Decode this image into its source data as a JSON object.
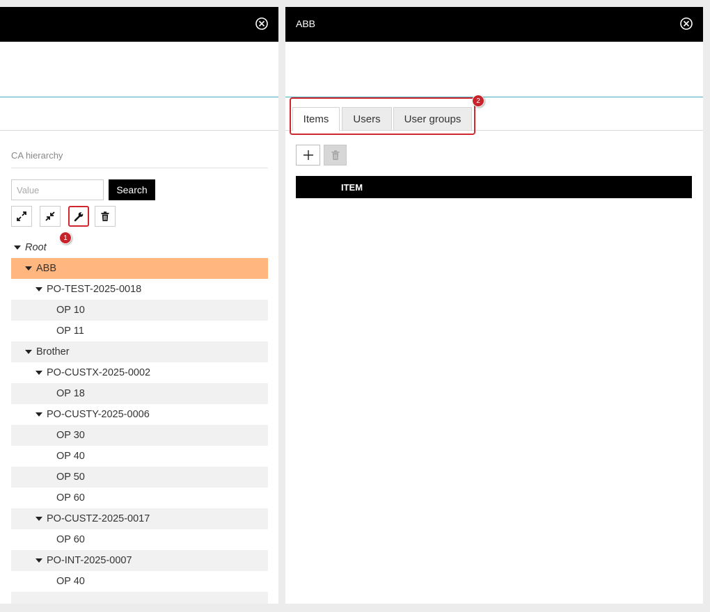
{
  "left_panel": {
    "title": "",
    "section_label": "CA hierarchy",
    "search": {
      "placeholder": "Value",
      "value": "",
      "button_label": "Search"
    },
    "toolbar": {
      "expand_icon": "expand-arrows-icon",
      "collapse_icon": "collapse-arrows-icon",
      "settings_icon": "wrench-icon",
      "delete_icon": "trash-icon",
      "badge": "1"
    },
    "tree": [
      {
        "label": "Root",
        "level": 0,
        "caret": true,
        "italic": true,
        "style": "plain"
      },
      {
        "label": "ABB",
        "level": 1,
        "caret": true,
        "style": "selected"
      },
      {
        "label": "PO-TEST-2025-0018",
        "level": 2,
        "caret": true,
        "style": "plain"
      },
      {
        "label": "OP 10",
        "level": 3,
        "caret": false,
        "style": "alt"
      },
      {
        "label": "OP 11",
        "level": 3,
        "caret": false,
        "style": "plain"
      },
      {
        "label": "Brother",
        "level": 1,
        "caret": true,
        "style": "alt"
      },
      {
        "label": "PO-CUSTX-2025-0002",
        "level": 2,
        "caret": true,
        "style": "plain"
      },
      {
        "label": "OP 18",
        "level": 3,
        "caret": false,
        "style": "alt"
      },
      {
        "label": "PO-CUSTY-2025-0006",
        "level": 2,
        "caret": true,
        "style": "plain"
      },
      {
        "label": "OP 30",
        "level": 3,
        "caret": false,
        "style": "alt"
      },
      {
        "label": "OP 40",
        "level": 3,
        "caret": false,
        "style": "plain"
      },
      {
        "label": "OP 50",
        "level": 3,
        "caret": false,
        "style": "alt"
      },
      {
        "label": "OP 60",
        "level": 3,
        "caret": false,
        "style": "plain"
      },
      {
        "label": "PO-CUSTZ-2025-0017",
        "level": 2,
        "caret": true,
        "style": "alt"
      },
      {
        "label": "OP 60",
        "level": 3,
        "caret": false,
        "style": "plain"
      },
      {
        "label": "PO-INT-2025-0007",
        "level": 2,
        "caret": true,
        "style": "alt"
      },
      {
        "label": "OP 40",
        "level": 3,
        "caret": false,
        "style": "plain"
      },
      {
        "label": "",
        "level": 3,
        "caret": false,
        "style": "alt"
      }
    ]
  },
  "right_panel": {
    "title": "ABB",
    "tabs": [
      {
        "label": "Items",
        "active": true
      },
      {
        "label": "Users",
        "active": false
      },
      {
        "label": "User groups",
        "active": false
      }
    ],
    "badge": "2",
    "add_icon": "plus-icon",
    "delete_icon": "trash-icon",
    "table": {
      "columns": [
        "ITEM"
      ]
    }
  },
  "colors": {
    "header": "#000000",
    "selected_row": "#ffb67f",
    "alt_row": "#f1f1f1",
    "accent_line": "#45aebd",
    "highlight": "#d0262e"
  }
}
